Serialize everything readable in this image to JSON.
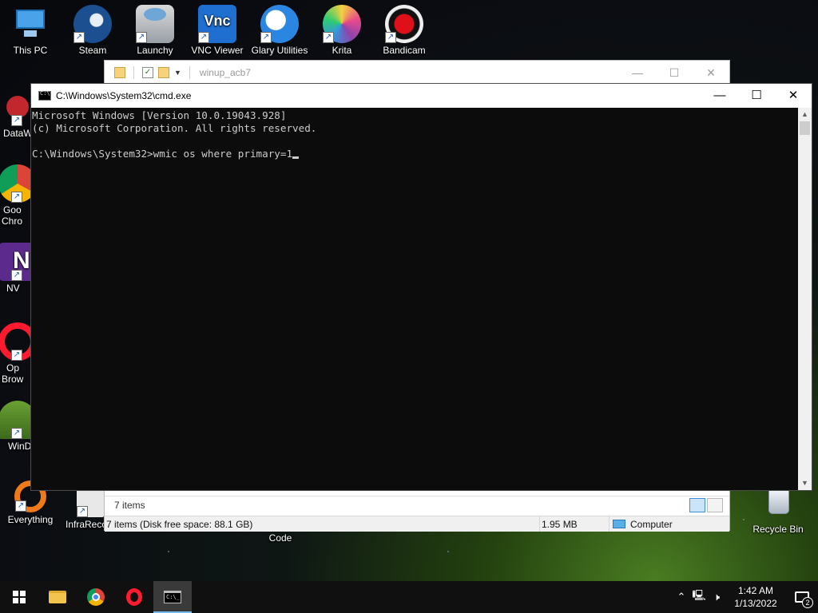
{
  "desktop": {
    "icons": [
      {
        "label": "This PC",
        "icon": "computer-icon",
        "color": "#4aa3e8"
      },
      {
        "label": "Steam",
        "icon": "steam-icon",
        "color": "#1b4f8f"
      },
      {
        "label": "Launchy",
        "icon": "launchy-icon",
        "color": "#c9c9c9"
      },
      {
        "label": "VNC Viewer",
        "icon": "vnc-icon",
        "color": "#1e6fd0"
      },
      {
        "label": "Glary Utilities",
        "icon": "glary-icon",
        "color": "#2a86e0"
      },
      {
        "label": "Krita",
        "icon": "krita-icon",
        "color": "#e84a8a"
      },
      {
        "label": "Bandicam",
        "icon": "bandicam-icon",
        "color": "#e0101a"
      },
      {
        "label": "DataW",
        "icon": "datawrapper-icon",
        "color": "#c1272d"
      },
      {
        "label": "Goo",
        "label2": "Chro",
        "icon": "chrome-icon",
        "color": "#2f9e44"
      },
      {
        "label": "NV",
        "icon": "nvda-icon",
        "color": "#5b2a8c"
      },
      {
        "label": "Op",
        "label2": "Brow",
        "icon": "opera-icon",
        "color": "#ff1b2d"
      },
      {
        "label": "WinD",
        "icon": "windirstat-icon",
        "color": "#5d8a2a"
      },
      {
        "label": "Everything",
        "icon": "everything-icon",
        "color": "#f07a1a"
      },
      {
        "label": "InfraReco",
        "icon": "infrarecorder-icon",
        "color": "#e8e8e8"
      },
      {
        "label": "Recycle Bin",
        "icon": "recycle-bin-icon",
        "color": "#d0d8e0"
      }
    ],
    "below_explorer_label": "Code"
  },
  "explorer": {
    "title": "winup_acb7",
    "status_items": "7 items",
    "status_detail": "7 items (Disk free space: 88.1 GB)",
    "status_size": "1.95 MB",
    "status_location": "Computer",
    "controls": {
      "minimize": "—",
      "maximize": "☐",
      "close": "✕"
    }
  },
  "cmd": {
    "title": "C:\\Windows\\System32\\cmd.exe",
    "controls": {
      "minimize": "—",
      "maximize": "☐",
      "close": "✕"
    },
    "lines": [
      "Microsoft Windows [Version 10.0.19043.928]",
      "(c) Microsoft Corporation. All rights reserved.",
      "",
      "C:\\Windows\\System32>wmic os where primary=1"
    ]
  },
  "taskbar": {
    "pinned": [
      {
        "name": "start-button",
        "icon": "windows-icon"
      },
      {
        "name": "file-explorer",
        "icon": "folder-icon"
      },
      {
        "name": "chrome",
        "icon": "chrome-icon"
      },
      {
        "name": "opera",
        "icon": "opera-icon"
      },
      {
        "name": "cmd",
        "icon": "cmd-icon",
        "active": true
      }
    ],
    "time": "1:42 AM",
    "date": "1/13/2022",
    "notification_count": "2"
  }
}
